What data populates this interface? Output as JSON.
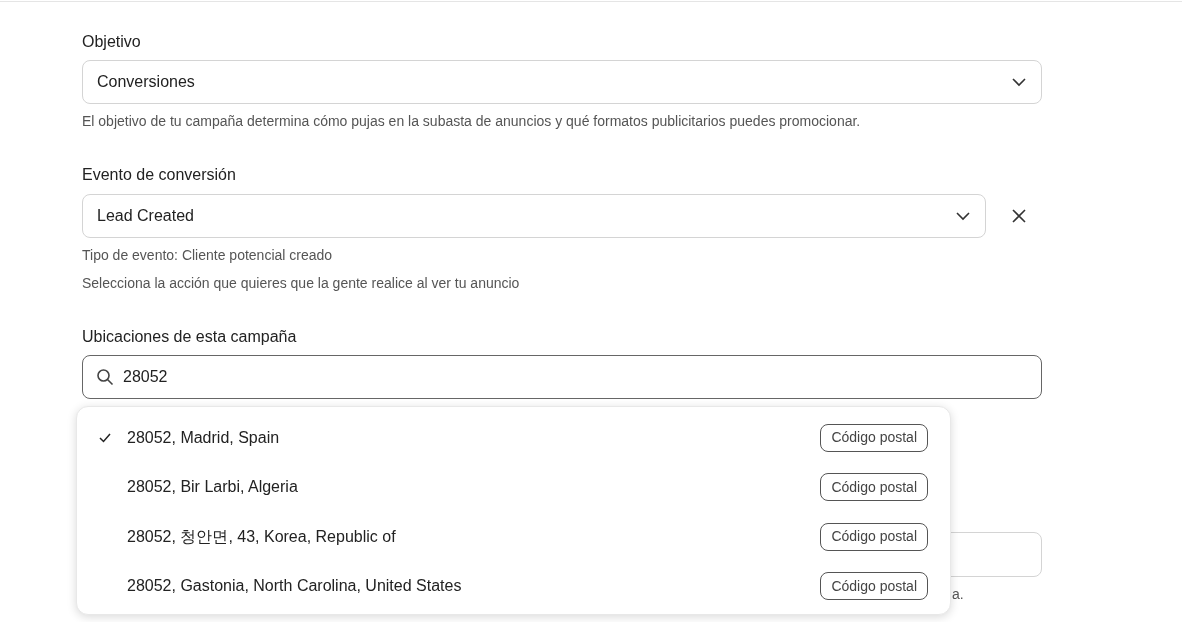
{
  "objective": {
    "label": "Objetivo",
    "value": "Conversiones",
    "help": "El objetivo de tu campaña determina cómo pujas en la subasta de anuncios y qué formatos publicitarios puedes promocionar."
  },
  "conversion_event": {
    "label": "Evento de conversión",
    "value": "Lead Created",
    "event_type": "Tipo de evento: Cliente potencial creado",
    "help": "Selecciona la acción que quieres que la gente realice al ver tu anuncio"
  },
  "locations": {
    "label": "Ubicaciones de esta campaña",
    "value": "28052",
    "results": [
      {
        "text": "28052, Madrid, Spain",
        "badge": "Código postal",
        "selected": true
      },
      {
        "text": "28052, Bir Larbi, Algeria",
        "badge": "Código postal",
        "selected": false
      },
      {
        "text": "28052, 청안면, 43, Korea, Republic of",
        "badge": "Código postal",
        "selected": false
      },
      {
        "text": "28052, Gastonia, North Carolina, United States",
        "badge": "Código postal",
        "selected": false
      }
    ]
  },
  "covered_hint": "a."
}
